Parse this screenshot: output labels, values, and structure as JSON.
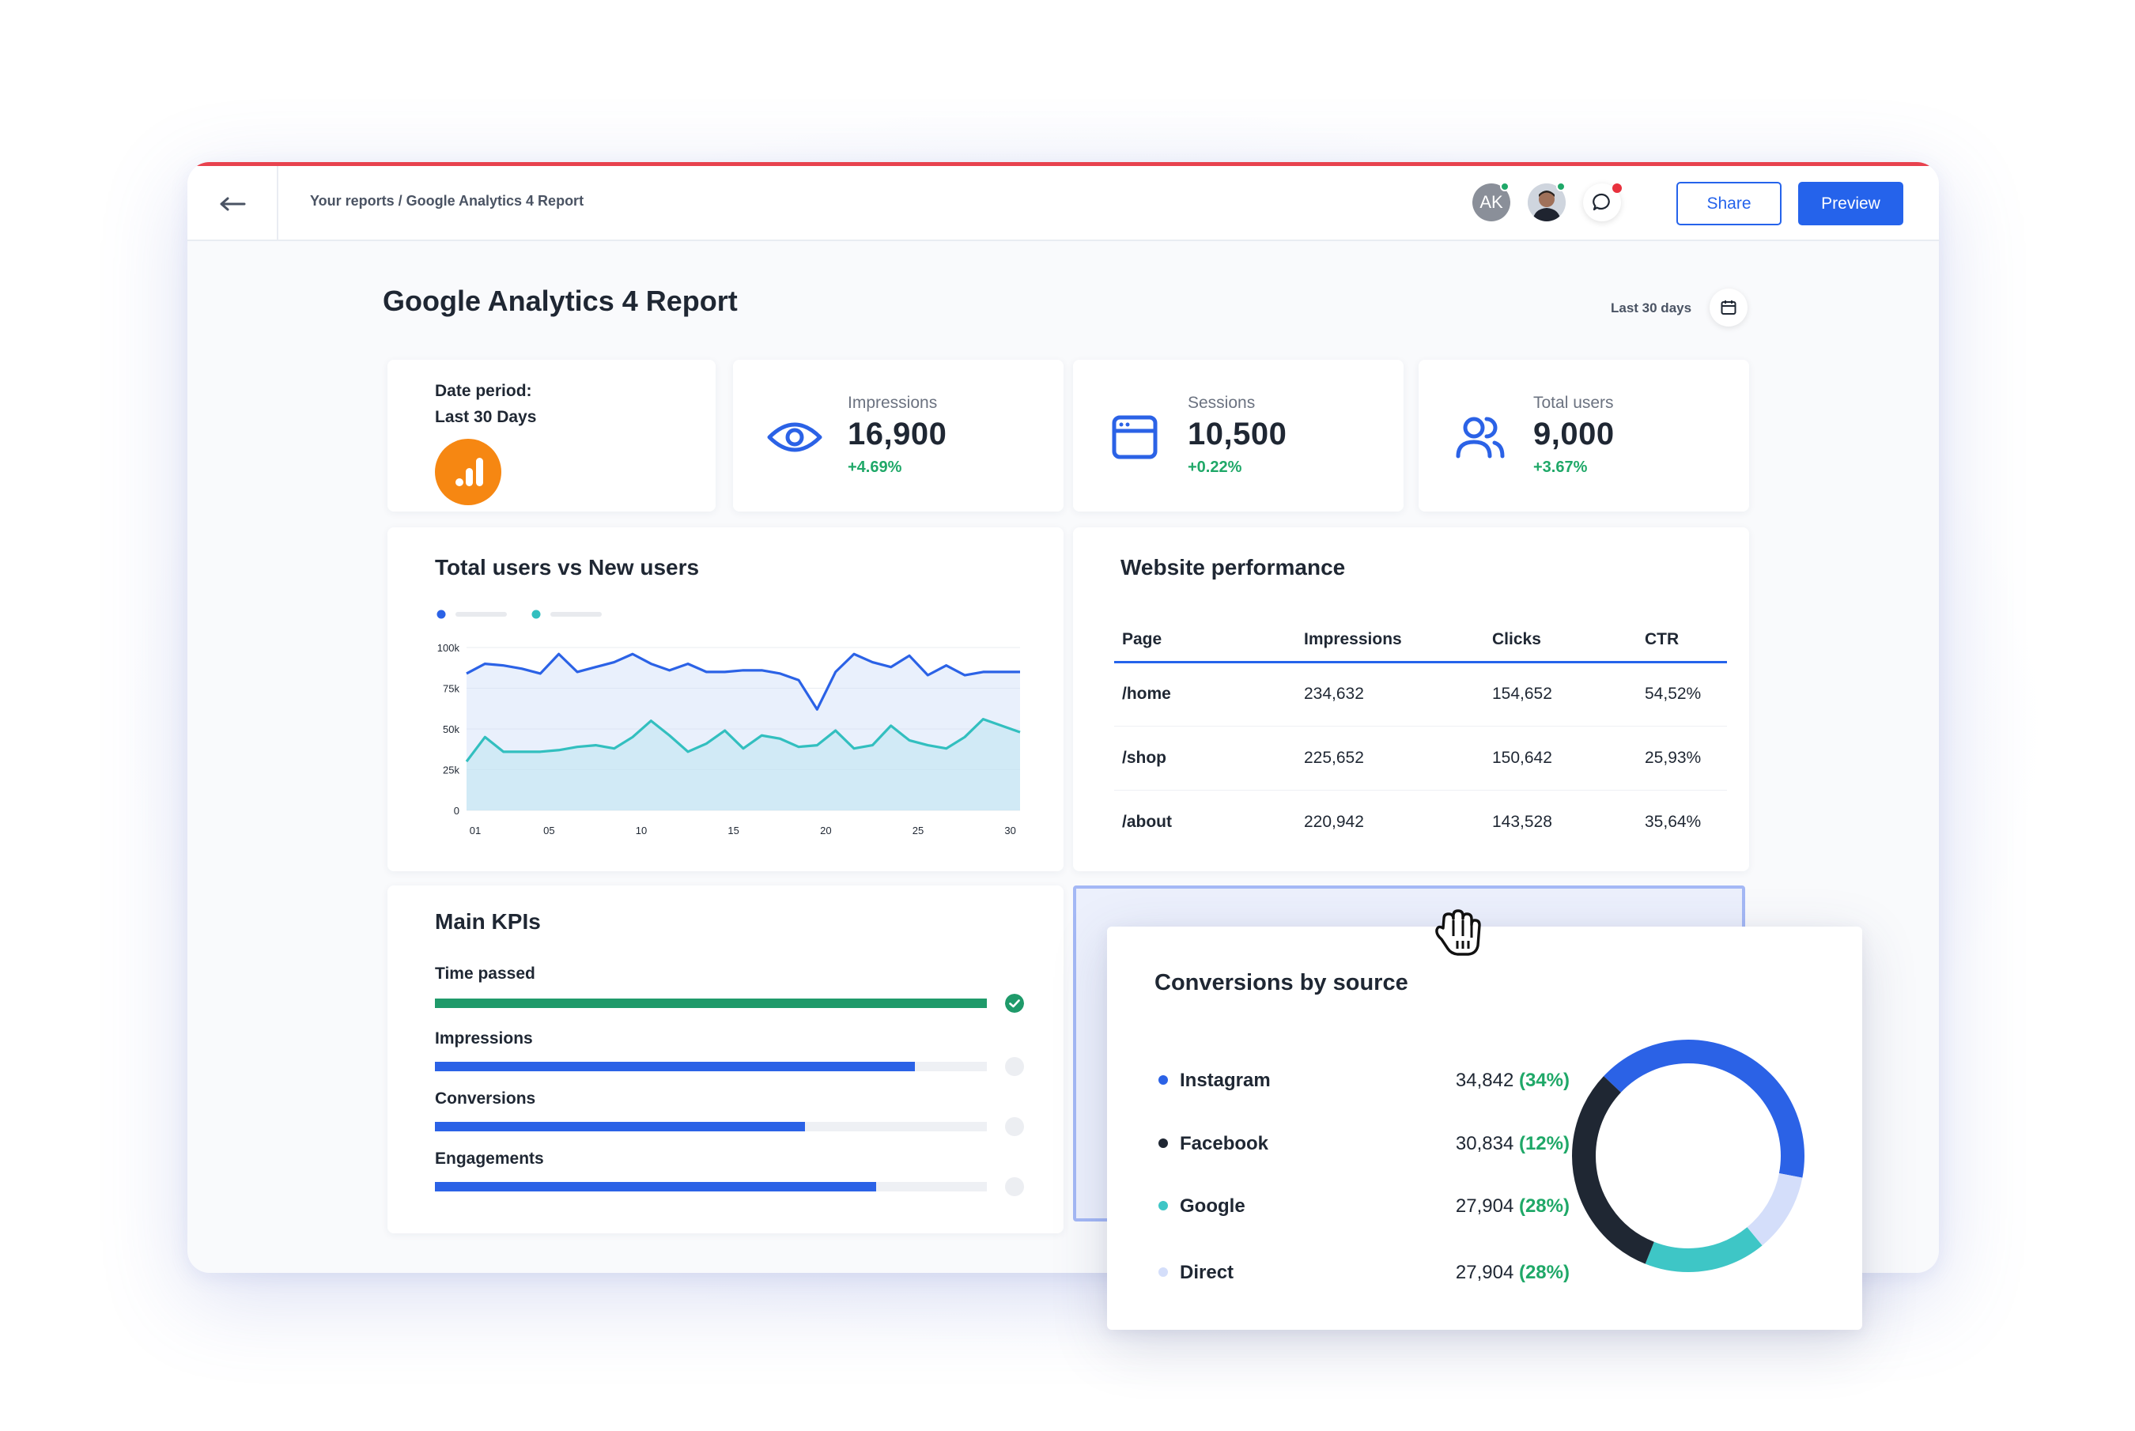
{
  "header": {
    "breadcrumb": "Your reports / Google Analytics 4 Report",
    "avatar_initials": "AK",
    "share_label": "Share",
    "preview_label": "Preview"
  },
  "page": {
    "title": "Google Analytics 4 Report",
    "date_range": "Last 30 days"
  },
  "date_card": {
    "label_line1": "Date period:",
    "label_line2": "Last 30 Days",
    "logo_color": "#f68712"
  },
  "stats": [
    {
      "label": "Impressions",
      "value": "16,900",
      "change": "+4.69%",
      "icon": "eye-icon"
    },
    {
      "label": "Sessions",
      "value": "10,500",
      "change": "+0.22%",
      "icon": "browser-window-icon"
    },
    {
      "label": "Total users",
      "value": "9,000",
      "change": "+3.67%",
      "icon": "users-icon"
    }
  ],
  "users_chart": {
    "title": "Total users vs New users"
  },
  "chart_data": {
    "type": "area",
    "title": "Total users vs New users",
    "xlabel": "",
    "ylabel": "",
    "x": [
      1,
      2,
      3,
      4,
      5,
      6,
      7,
      8,
      9,
      10,
      11,
      12,
      13,
      14,
      15,
      16,
      17,
      18,
      19,
      20,
      21,
      22,
      23,
      24,
      25,
      26,
      27,
      28,
      29,
      30,
      31
    ],
    "x_ticks": [
      "01",
      "05",
      "10",
      "15",
      "20",
      "25",
      "30"
    ],
    "x_tick_values": [
      1,
      5,
      10,
      15,
      20,
      25,
      30
    ],
    "y_ticks": [
      "0",
      "25k",
      "50k",
      "75k",
      "100k"
    ],
    "y_tick_values": [
      0,
      25000,
      50000,
      75000,
      100000
    ],
    "ylim": [
      0,
      100000
    ],
    "grid": true,
    "legend": "top-left",
    "series": [
      {
        "color": "#2b62e6",
        "values": [
          84000,
          90000,
          89000,
          87000,
          84000,
          96000,
          85000,
          88000,
          91000,
          96000,
          90000,
          86000,
          90000,
          85000,
          85000,
          86000,
          86000,
          84000,
          80000,
          62000,
          85000,
          96000,
          91000,
          88000,
          95000,
          83000,
          89000,
          83000,
          85000,
          85000,
          85000
        ]
      },
      {
        "color": "#32bfbf",
        "values": [
          30000,
          45000,
          36000,
          36000,
          36000,
          37000,
          39000,
          40000,
          38000,
          45000,
          55000,
          46000,
          36000,
          41000,
          49000,
          38000,
          46000,
          44000,
          39000,
          40000,
          49000,
          38000,
          40000,
          52000,
          43000,
          40000,
          38000,
          45000,
          56000,
          52000,
          48000
        ]
      }
    ]
  },
  "web_perf": {
    "title": "Website performance",
    "columns": [
      "Page",
      "Impressions",
      "Clicks",
      "CTR"
    ],
    "rows": [
      [
        "/home",
        "234,632",
        "154,652",
        "54,52%"
      ],
      [
        "/shop",
        "225,652",
        "150,642",
        "25,93%"
      ],
      [
        "/about",
        "220,942",
        "143,528",
        "35,64%"
      ]
    ]
  },
  "kpis": {
    "title": "Main KPIs",
    "items": [
      {
        "label": "Time passed",
        "progress": 1.0,
        "color": "#1f9a6a",
        "done": true
      },
      {
        "label": "Impressions",
        "progress": 0.87,
        "color": "#2b62e6",
        "done": false
      },
      {
        "label": "Conversions",
        "progress": 0.67,
        "color": "#2b62e6",
        "done": false
      },
      {
        "label": "Engagements",
        "progress": 0.8,
        "color": "#2b62e6",
        "done": false
      }
    ]
  },
  "conversions": {
    "title": "Conversions by source",
    "items": [
      {
        "name": "Instagram",
        "value": "34,842",
        "pct": "(34%)",
        "color": "#2b62e6"
      },
      {
        "name": "Facebook",
        "value": "30,834",
        "pct": "(12%)",
        "color": "#1f2733"
      },
      {
        "name": "Google",
        "value": "27,904",
        "pct": "(28%)",
        "color": "#3ec6c6"
      },
      {
        "name": "Direct",
        "value": "27,904",
        "pct": "(28%)",
        "color": "#d4defa"
      }
    ],
    "donut_shares": [
      0.41,
      0.11,
      0.17,
      0.31
    ],
    "donut_colors": [
      "#2b62e6",
      "#d4defa",
      "#3ec6c6",
      "#1f2733"
    ]
  }
}
